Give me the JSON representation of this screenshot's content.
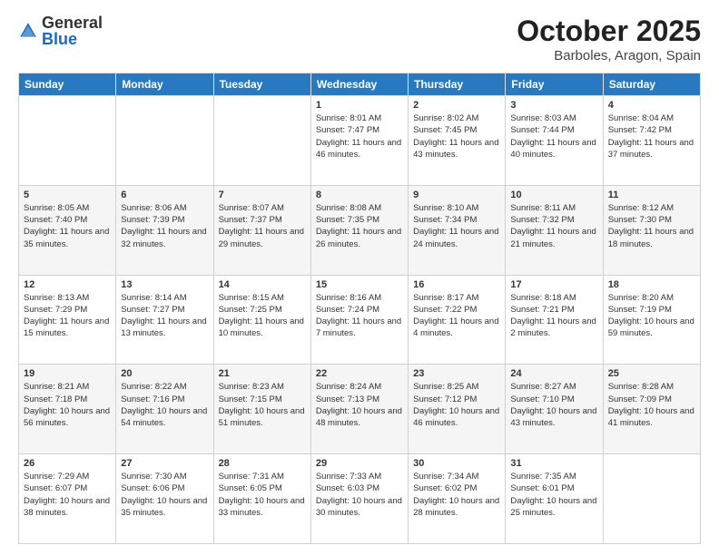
{
  "logo": {
    "general": "General",
    "blue": "Blue"
  },
  "title": "October 2025",
  "location": "Barboles, Aragon, Spain",
  "days_header": [
    "Sunday",
    "Monday",
    "Tuesday",
    "Wednesday",
    "Thursday",
    "Friday",
    "Saturday"
  ],
  "weeks": [
    [
      {
        "day": "",
        "info": ""
      },
      {
        "day": "",
        "info": ""
      },
      {
        "day": "",
        "info": ""
      },
      {
        "day": "1",
        "info": "Sunrise: 8:01 AM\nSunset: 7:47 PM\nDaylight: 11 hours and 46 minutes."
      },
      {
        "day": "2",
        "info": "Sunrise: 8:02 AM\nSunset: 7:45 PM\nDaylight: 11 hours and 43 minutes."
      },
      {
        "day": "3",
        "info": "Sunrise: 8:03 AM\nSunset: 7:44 PM\nDaylight: 11 hours and 40 minutes."
      },
      {
        "day": "4",
        "info": "Sunrise: 8:04 AM\nSunset: 7:42 PM\nDaylight: 11 hours and 37 minutes."
      }
    ],
    [
      {
        "day": "5",
        "info": "Sunrise: 8:05 AM\nSunset: 7:40 PM\nDaylight: 11 hours and 35 minutes."
      },
      {
        "day": "6",
        "info": "Sunrise: 8:06 AM\nSunset: 7:39 PM\nDaylight: 11 hours and 32 minutes."
      },
      {
        "day": "7",
        "info": "Sunrise: 8:07 AM\nSunset: 7:37 PM\nDaylight: 11 hours and 29 minutes."
      },
      {
        "day": "8",
        "info": "Sunrise: 8:08 AM\nSunset: 7:35 PM\nDaylight: 11 hours and 26 minutes."
      },
      {
        "day": "9",
        "info": "Sunrise: 8:10 AM\nSunset: 7:34 PM\nDaylight: 11 hours and 24 minutes."
      },
      {
        "day": "10",
        "info": "Sunrise: 8:11 AM\nSunset: 7:32 PM\nDaylight: 11 hours and 21 minutes."
      },
      {
        "day": "11",
        "info": "Sunrise: 8:12 AM\nSunset: 7:30 PM\nDaylight: 11 hours and 18 minutes."
      }
    ],
    [
      {
        "day": "12",
        "info": "Sunrise: 8:13 AM\nSunset: 7:29 PM\nDaylight: 11 hours and 15 minutes."
      },
      {
        "day": "13",
        "info": "Sunrise: 8:14 AM\nSunset: 7:27 PM\nDaylight: 11 hours and 13 minutes."
      },
      {
        "day": "14",
        "info": "Sunrise: 8:15 AM\nSunset: 7:25 PM\nDaylight: 11 hours and 10 minutes."
      },
      {
        "day": "15",
        "info": "Sunrise: 8:16 AM\nSunset: 7:24 PM\nDaylight: 11 hours and 7 minutes."
      },
      {
        "day": "16",
        "info": "Sunrise: 8:17 AM\nSunset: 7:22 PM\nDaylight: 11 hours and 4 minutes."
      },
      {
        "day": "17",
        "info": "Sunrise: 8:18 AM\nSunset: 7:21 PM\nDaylight: 11 hours and 2 minutes."
      },
      {
        "day": "18",
        "info": "Sunrise: 8:20 AM\nSunset: 7:19 PM\nDaylight: 10 hours and 59 minutes."
      }
    ],
    [
      {
        "day": "19",
        "info": "Sunrise: 8:21 AM\nSunset: 7:18 PM\nDaylight: 10 hours and 56 minutes."
      },
      {
        "day": "20",
        "info": "Sunrise: 8:22 AM\nSunset: 7:16 PM\nDaylight: 10 hours and 54 minutes."
      },
      {
        "day": "21",
        "info": "Sunrise: 8:23 AM\nSunset: 7:15 PM\nDaylight: 10 hours and 51 minutes."
      },
      {
        "day": "22",
        "info": "Sunrise: 8:24 AM\nSunset: 7:13 PM\nDaylight: 10 hours and 48 minutes."
      },
      {
        "day": "23",
        "info": "Sunrise: 8:25 AM\nSunset: 7:12 PM\nDaylight: 10 hours and 46 minutes."
      },
      {
        "day": "24",
        "info": "Sunrise: 8:27 AM\nSunset: 7:10 PM\nDaylight: 10 hours and 43 minutes."
      },
      {
        "day": "25",
        "info": "Sunrise: 8:28 AM\nSunset: 7:09 PM\nDaylight: 10 hours and 41 minutes."
      }
    ],
    [
      {
        "day": "26",
        "info": "Sunrise: 7:29 AM\nSunset: 6:07 PM\nDaylight: 10 hours and 38 minutes."
      },
      {
        "day": "27",
        "info": "Sunrise: 7:30 AM\nSunset: 6:06 PM\nDaylight: 10 hours and 35 minutes."
      },
      {
        "day": "28",
        "info": "Sunrise: 7:31 AM\nSunset: 6:05 PM\nDaylight: 10 hours and 33 minutes."
      },
      {
        "day": "29",
        "info": "Sunrise: 7:33 AM\nSunset: 6:03 PM\nDaylight: 10 hours and 30 minutes."
      },
      {
        "day": "30",
        "info": "Sunrise: 7:34 AM\nSunset: 6:02 PM\nDaylight: 10 hours and 28 minutes."
      },
      {
        "day": "31",
        "info": "Sunrise: 7:35 AM\nSunset: 6:01 PM\nDaylight: 10 hours and 25 minutes."
      },
      {
        "day": "",
        "info": ""
      }
    ]
  ]
}
